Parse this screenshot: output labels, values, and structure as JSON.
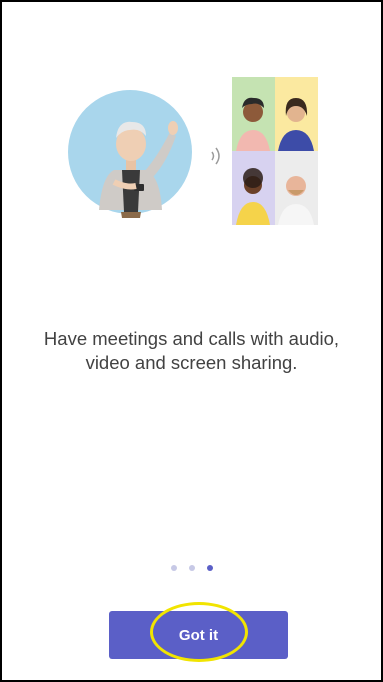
{
  "onboarding": {
    "headline_line1": "Have meetings and calls with audio,",
    "headline_line2": "video and screen sharing.",
    "illustration_icon": "video-call-illustration",
    "page_indicator": {
      "total": 3,
      "current": 3
    },
    "cta_label": "Got it"
  },
  "colors": {
    "accent": "#5b5fc7",
    "dot_inactive": "#c7c9e6",
    "highlight": "#f1e400",
    "text": "#424242"
  }
}
